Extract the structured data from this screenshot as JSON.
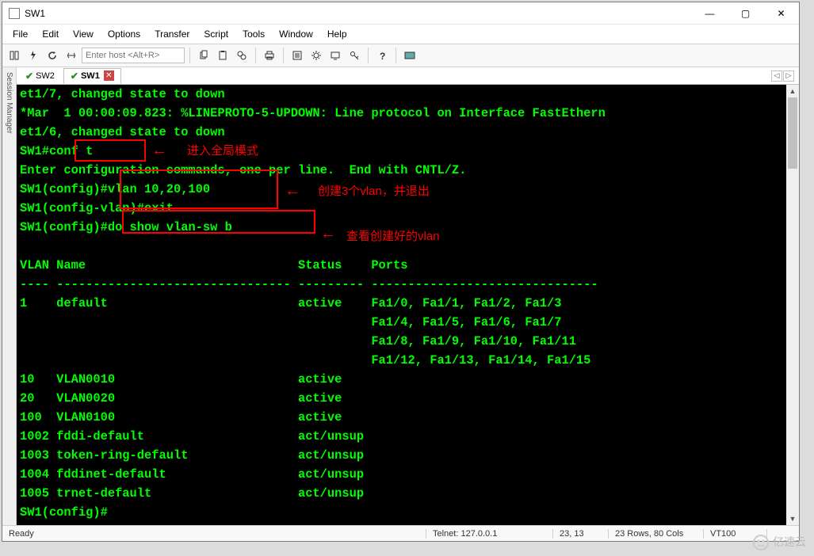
{
  "window": {
    "title": "SW1",
    "min_icon": "—",
    "max_icon": "▢",
    "close_icon": "✕"
  },
  "menu": {
    "file": "File",
    "edit": "Edit",
    "view": "View",
    "options": "Options",
    "transfer": "Transfer",
    "script": "Script",
    "tools": "Tools",
    "window": "Window",
    "help": "Help"
  },
  "toolbar": {
    "host_placeholder": "Enter host <Alt+R>"
  },
  "sidebar": {
    "label": "Session Manager"
  },
  "tabs": {
    "items": [
      {
        "label": "SW2",
        "active": false
      },
      {
        "label": "SW1",
        "active": true
      }
    ],
    "scroll_left": "◁",
    "scroll_right": "▷"
  },
  "terminal": {
    "lines": [
      "et1/7, changed state to down",
      "*Mar  1 00:00:09.823: %LINEPROTO-5-UPDOWN: Line protocol on Interface FastEthern",
      "et1/6, changed state to down",
      "SW1#conf t",
      "Enter configuration commands, one per line.  End with CNTL/Z.",
      "SW1(config)#vlan 10,20,100",
      "SW1(config-vlan)#exit",
      "SW1(config)#do show vlan-sw b",
      "",
      "VLAN Name                             Status    Ports",
      "---- -------------------------------- --------- -------------------------------",
      "1    default                          active    Fa1/0, Fa1/1, Fa1/2, Fa1/3",
      "                                                Fa1/4, Fa1/5, Fa1/6, Fa1/7",
      "                                                Fa1/8, Fa1/9, Fa1/10, Fa1/11",
      "                                                Fa1/12, Fa1/13, Fa1/14, Fa1/15",
      "10   VLAN0010                         active",
      "20   VLAN0020                         active",
      "100  VLAN0100                         active",
      "1002 fddi-default                     act/unsup",
      "1003 token-ring-default               act/unsup",
      "1004 fddinet-default                  act/unsup",
      "1005 trnet-default                    act/unsup",
      "SW1(config)#"
    ]
  },
  "annotations": {
    "label1": "进入全局模式",
    "label2": "创建3个vlan，并退出",
    "label3": "查看创建好的vlan",
    "arrow": "←"
  },
  "statusbar": {
    "ready": "Ready",
    "proto": "Telnet: 127.0.0.1",
    "pos": "23,  13",
    "size": "23 Rows, 80 Cols",
    "emu": "VT100"
  },
  "watermark": "亿速云"
}
